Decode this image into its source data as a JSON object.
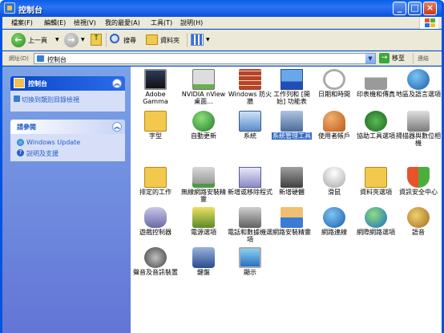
{
  "title": "控制台",
  "menu": [
    "檔案(F)",
    "編輯(E)",
    "檢視(V)",
    "我的最愛(A)",
    "工具(T)",
    "說明(H)"
  ],
  "toolbar": {
    "back": "上一頁",
    "search": "搜尋",
    "folders": "資料夾"
  },
  "address": {
    "label": "網址(D)",
    "value": "控制台",
    "go": "移至",
    "links": "連結"
  },
  "side": {
    "cp_title": "控制台",
    "switch": "切換到類別目錄檢視",
    "see_also": "請參閱",
    "windows_update": "Windows Update",
    "help": "說明及支援"
  },
  "items": [
    {
      "label": "Adobe Gamma",
      "icon": "monitor-icon"
    },
    {
      "label": "NVIDIA nView 桌面...",
      "icon": "nvidia-icon"
    },
    {
      "label": "Windows 防火牆",
      "icon": "firewall-icon"
    },
    {
      "label": "工作列和 [開始] 功能表",
      "icon": "taskbar-icon"
    },
    {
      "label": "日期和時間",
      "icon": "clock-icon"
    },
    {
      "label": "印表機和傳真",
      "icon": "printer-icon"
    },
    {
      "label": "地區及語言選項",
      "icon": "globe-icon"
    },
    {
      "label": "字型",
      "icon": "font-folder-icon"
    },
    {
      "label": "自動更新",
      "icon": "update-icon"
    },
    {
      "label": "系統",
      "icon": "system-icon"
    },
    {
      "label": "系統管理工具",
      "icon": "admin-tools-icon"
    },
    {
      "label": "使用者帳戶",
      "icon": "users-icon"
    },
    {
      "label": "協助工具選項",
      "icon": "accessibility-icon"
    },
    {
      "label": "掃描器與數位相機",
      "icon": "scanner-icon"
    },
    {
      "label": "排定的工作",
      "icon": "tasks-folder-icon"
    },
    {
      "label": "無線網路安裝精靈",
      "icon": "wireless-icon"
    },
    {
      "label": "新增或移除程式",
      "icon": "add-remove-icon"
    },
    {
      "label": "新增硬體",
      "icon": "hardware-icon"
    },
    {
      "label": "滑鼠",
      "icon": "mouse-icon"
    },
    {
      "label": "資料夾選項",
      "icon": "folder-options-icon"
    },
    {
      "label": "資訊安全中心",
      "icon": "security-shield-icon"
    },
    {
      "label": "遊戲控制器",
      "icon": "gamepad-icon"
    },
    {
      "label": "電源選項",
      "icon": "power-icon"
    },
    {
      "label": "電話和數據機選項",
      "icon": "phone-icon"
    },
    {
      "label": "網路安裝精靈",
      "icon": "network-wizard-icon"
    },
    {
      "label": "網路連線",
      "icon": "network-icon"
    },
    {
      "label": "網際網路選項",
      "icon": "internet-icon"
    },
    {
      "label": "語音",
      "icon": "speech-icon"
    },
    {
      "label": "聲音及音訊裝置",
      "icon": "speaker-icon"
    },
    {
      "label": "鍵盤",
      "icon": "keyboard-icon"
    },
    {
      "label": "顯示",
      "icon": "display-icon"
    }
  ],
  "selected_index": 10
}
